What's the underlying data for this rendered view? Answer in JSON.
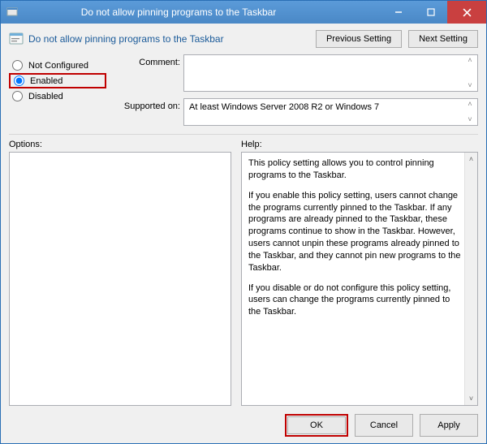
{
  "titlebar": {
    "title": "Do not allow pinning programs to the Taskbar"
  },
  "header": {
    "heading": "Do not allow pinning programs to the Taskbar",
    "previous_setting": "Previous Setting",
    "next_setting": "Next Setting"
  },
  "radios": {
    "not_configured": "Not Configured",
    "enabled": "Enabled",
    "disabled": "Disabled",
    "selected": "enabled"
  },
  "fields": {
    "comment_label": "Comment:",
    "comment_value": "",
    "supported_label": "Supported on:",
    "supported_value": "At least Windows Server 2008 R2 or Windows 7"
  },
  "panes": {
    "options_label": "Options:",
    "help_label": "Help:",
    "help_p1": "This policy setting allows you to control pinning programs to the Taskbar.",
    "help_p2": "If you enable this policy setting, users cannot change the programs currently pinned to the Taskbar. If any programs are already pinned to the Taskbar, these programs continue to show in the Taskbar. However, users cannot unpin these programs already pinned to the Taskbar, and they cannot pin new programs to the Taskbar.",
    "help_p3": "If you disable or do not configure this policy setting, users can change the programs currently pinned to the Taskbar."
  },
  "footer": {
    "ok": "OK",
    "cancel": "Cancel",
    "apply": "Apply"
  }
}
